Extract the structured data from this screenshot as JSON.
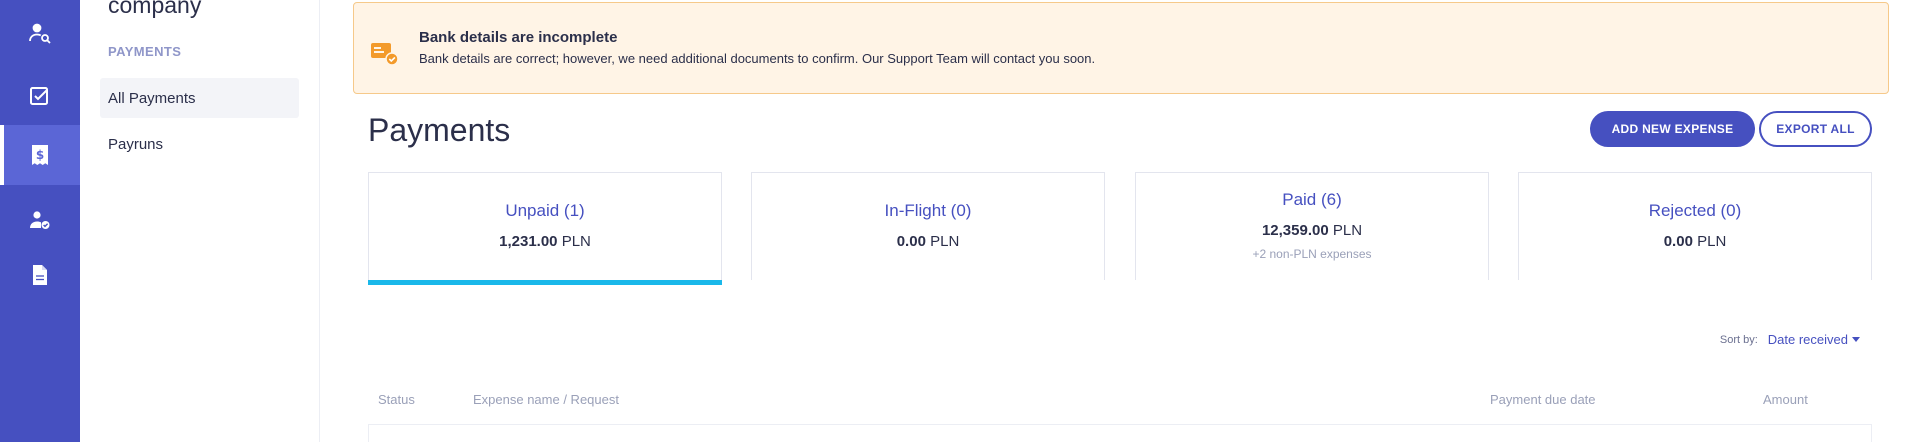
{
  "sidebar": {
    "company": "company",
    "section_label": "PAYMENTS",
    "items": [
      {
        "label": "All Payments"
      },
      {
        "label": "Payruns"
      }
    ]
  },
  "rail": {
    "icons": [
      "user-search-icon",
      "checkbox-icon",
      "dollar-receipt-icon",
      "user-check-icon",
      "document-icon"
    ],
    "active_index": 2
  },
  "banner": {
    "title": "Bank details are incomplete",
    "text": "Bank details are correct; however, we need additional documents to confirm. Our Support Team will contact you soon."
  },
  "page": {
    "title": "Payments",
    "add_button": "ADD NEW EXPENSE",
    "export_button": "EXPORT ALL"
  },
  "cards": [
    {
      "title": "Unpaid (1)",
      "amount": "1,231.00",
      "currency": "PLN",
      "note": ""
    },
    {
      "title": "In-Flight (0)",
      "amount": "0.00",
      "currency": "PLN",
      "note": ""
    },
    {
      "title": "Paid (6)",
      "amount": "12,359.00",
      "currency": "PLN",
      "note": "+2 non-PLN expenses"
    },
    {
      "title": "Rejected (0)",
      "amount": "0.00",
      "currency": "PLN",
      "note": ""
    }
  ],
  "sort": {
    "label": "Sort by:",
    "value": "Date received"
  },
  "table": {
    "columns": [
      "Status",
      "Expense name / Request",
      "Payment due date",
      "Amount"
    ]
  },
  "colors": {
    "rail": "#4650c0",
    "accent": "#4650c0",
    "active_tab": "#1ab8ea",
    "banner_bg": "#fff4e6",
    "banner_icon": "#f39a2b"
  }
}
